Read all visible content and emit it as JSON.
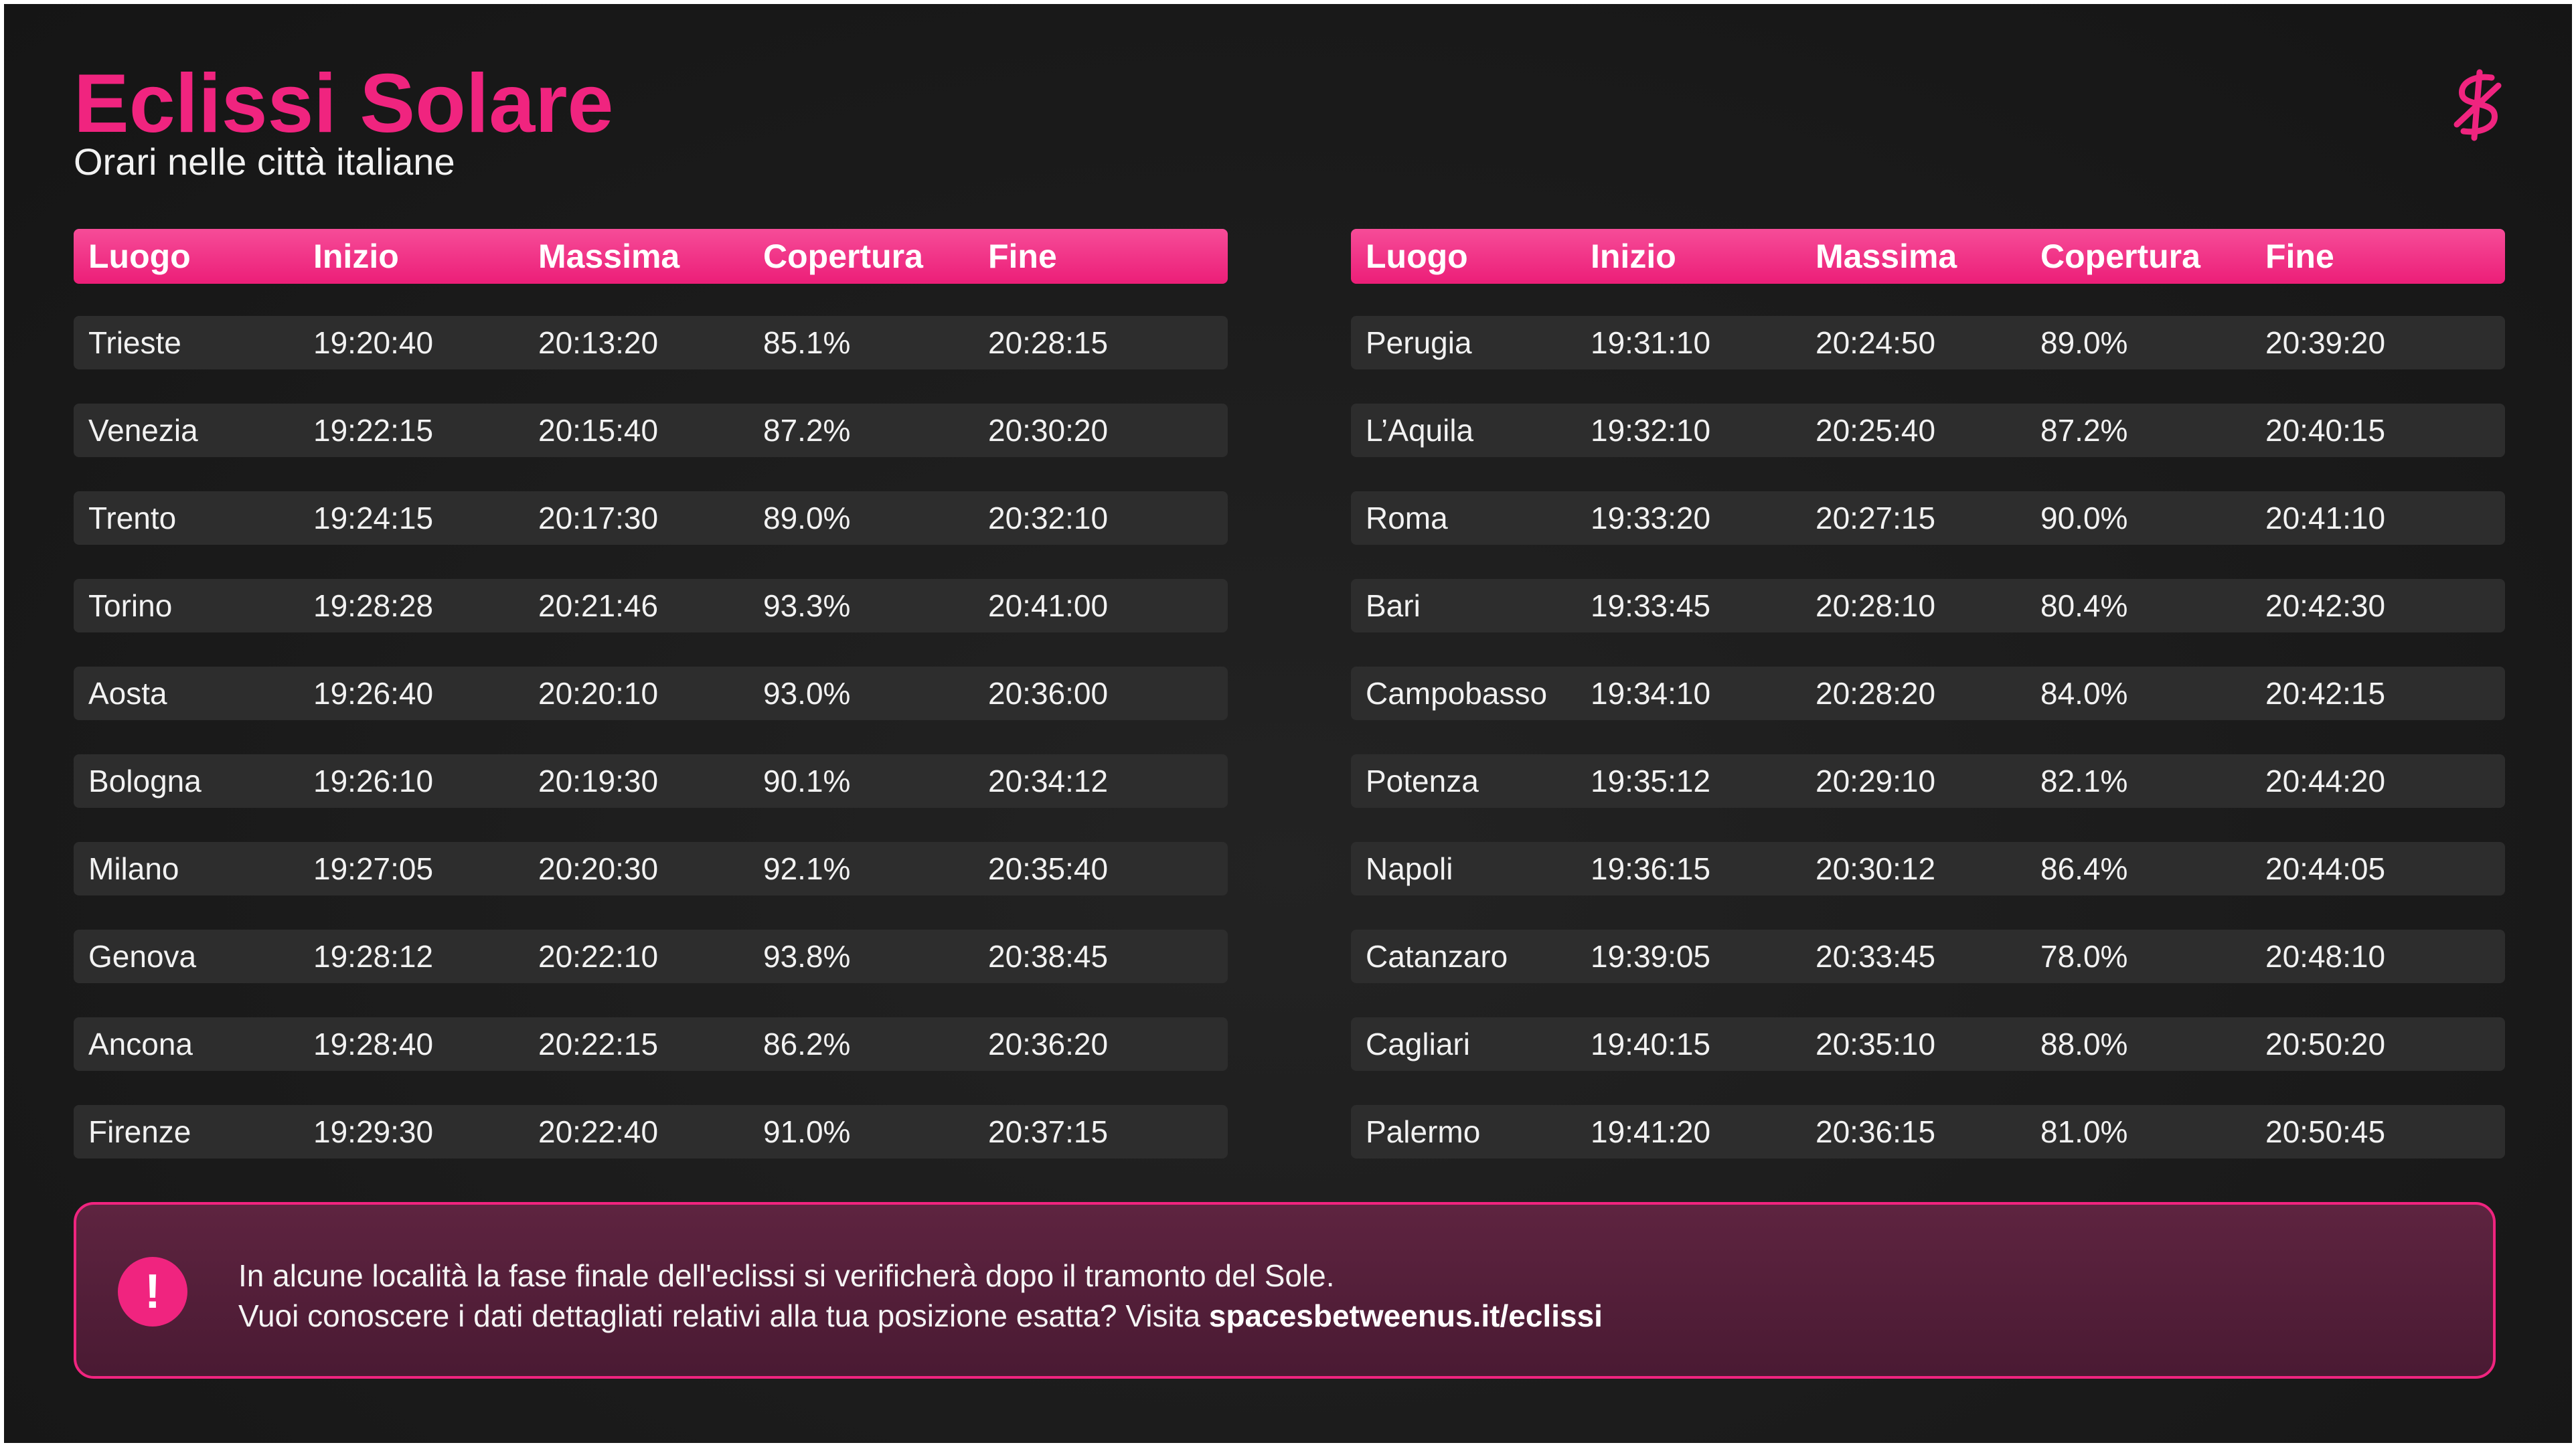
{
  "header": {
    "title": "Eclissi Solare",
    "subtitle": "Orari nelle città italiane"
  },
  "table_columns": [
    "Luogo",
    "Inizio",
    "Massima",
    "Copertura",
    "Fine"
  ],
  "tables": [
    {
      "rows": [
        [
          "Trieste",
          "19:20:40",
          "20:13:20",
          "85.1%",
          "20:28:15"
        ],
        [
          "Venezia",
          "19:22:15",
          "20:15:40",
          "87.2%",
          "20:30:20"
        ],
        [
          "Trento",
          "19:24:15",
          "20:17:30",
          "89.0%",
          "20:32:10"
        ],
        [
          "Torino",
          "19:28:28",
          "20:21:46",
          "93.3%",
          "20:41:00"
        ],
        [
          "Aosta",
          "19:26:40",
          "20:20:10",
          "93.0%",
          "20:36:00"
        ],
        [
          "Bologna",
          "19:26:10",
          "20:19:30",
          "90.1%",
          "20:34:12"
        ],
        [
          "Milano",
          "19:27:05",
          "20:20:30",
          "92.1%",
          "20:35:40"
        ],
        [
          "Genova",
          "19:28:12",
          "20:22:10",
          "93.8%",
          "20:38:45"
        ],
        [
          "Ancona",
          "19:28:40",
          "20:22:15",
          "86.2%",
          "20:36:20"
        ],
        [
          "Firenze",
          "19:29:30",
          "20:22:40",
          "91.0%",
          "20:37:15"
        ]
      ]
    },
    {
      "rows": [
        [
          "Perugia",
          "19:31:10",
          "20:24:50",
          "89.0%",
          "20:39:20"
        ],
        [
          "L’Aquila",
          "19:32:10",
          "20:25:40",
          "87.2%",
          "20:40:15"
        ],
        [
          "Roma",
          "19:33:20",
          "20:27:15",
          "90.0%",
          "20:41:10"
        ],
        [
          "Bari",
          "19:33:45",
          "20:28:10",
          "80.4%",
          "20:42:30"
        ],
        [
          "Campobasso",
          "19:34:10",
          "20:28:20",
          "84.0%",
          "20:42:15"
        ],
        [
          "Potenza",
          "19:35:12",
          "20:29:10",
          "82.1%",
          "20:44:20"
        ],
        [
          "Napoli",
          "19:36:15",
          "20:30:12",
          "86.4%",
          "20:44:05"
        ],
        [
          "Catanzaro",
          "19:39:05",
          "20:33:45",
          "78.0%",
          "20:48:10"
        ],
        [
          "Cagliari",
          "19:40:15",
          "20:35:10",
          "88.0%",
          "20:50:20"
        ],
        [
          "Palermo",
          "19:41:20",
          "20:36:15",
          "81.0%",
          "20:50:45"
        ]
      ]
    }
  ],
  "notice": {
    "icon": "!",
    "line1": "In alcune località la fase finale dell'eclissi si verificherà dopo il tramonto del Sole.",
    "line2_prefix": "Vuoi conoscere i dati dettagliati relativi alla tua posizione esatta? Visita ",
    "line2_link": "spacesbetweenus.it/eclissi"
  },
  "colors": {
    "accent": "#f0247f",
    "background": "#1b1b1b",
    "row": "#2d2d2d",
    "notice_bg": "#531d38"
  },
  "icons": {
    "logo": "spaces-between-us-logo-icon",
    "notice": "exclamation-icon"
  }
}
